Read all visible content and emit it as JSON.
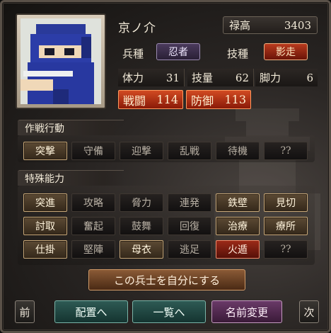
{
  "unit": {
    "name": "京ノ介",
    "rokudaka_label": "禄高",
    "rokudaka_value": "3403",
    "troop_label": "兵種",
    "troop_value": "忍者",
    "skill_label": "技種",
    "skill_value": "影走"
  },
  "stats": [
    {
      "label": "体力",
      "value": "31"
    },
    {
      "label": "技量",
      "value": "62"
    },
    {
      "label": "脚力",
      "value": "6"
    },
    {
      "label": "戦闘",
      "value": "114"
    },
    {
      "label": "防御",
      "value": "113"
    }
  ],
  "tactics": {
    "title": "作戦行動",
    "items": [
      {
        "label": "突撃",
        "state": "on"
      },
      {
        "label": "守備",
        "state": "off"
      },
      {
        "label": "迎撃",
        "state": "off"
      },
      {
        "label": "乱戦",
        "state": "off"
      },
      {
        "label": "待機",
        "state": "off"
      },
      {
        "label": "??",
        "state": "off"
      }
    ]
  },
  "abilities": {
    "title": "特殊能力",
    "items": [
      {
        "label": "突進",
        "state": "on"
      },
      {
        "label": "攻略",
        "state": "off"
      },
      {
        "label": "脅力",
        "state": "off"
      },
      {
        "label": "連発",
        "state": "off"
      },
      {
        "label": "鉄壁",
        "state": "on"
      },
      {
        "label": "見切",
        "state": "on"
      },
      {
        "label": "討取",
        "state": "on"
      },
      {
        "label": "奮起",
        "state": "off"
      },
      {
        "label": "鼓舞",
        "state": "off"
      },
      {
        "label": "回復",
        "state": "off"
      },
      {
        "label": "治療",
        "state": "on"
      },
      {
        "label": "療所",
        "state": "on"
      },
      {
        "label": "仕掛",
        "state": "on"
      },
      {
        "label": "堅陣",
        "state": "off"
      },
      {
        "label": "母衣",
        "state": "on"
      },
      {
        "label": "逃足",
        "state": "off"
      },
      {
        "label": "火遁",
        "state": "red"
      },
      {
        "label": "??",
        "state": "off"
      }
    ]
  },
  "actions": {
    "adopt": "この兵士を自分にする",
    "prev": "前",
    "deploy": "配置へ",
    "list": "一覧へ",
    "rename": "名前変更",
    "next": "次"
  }
}
